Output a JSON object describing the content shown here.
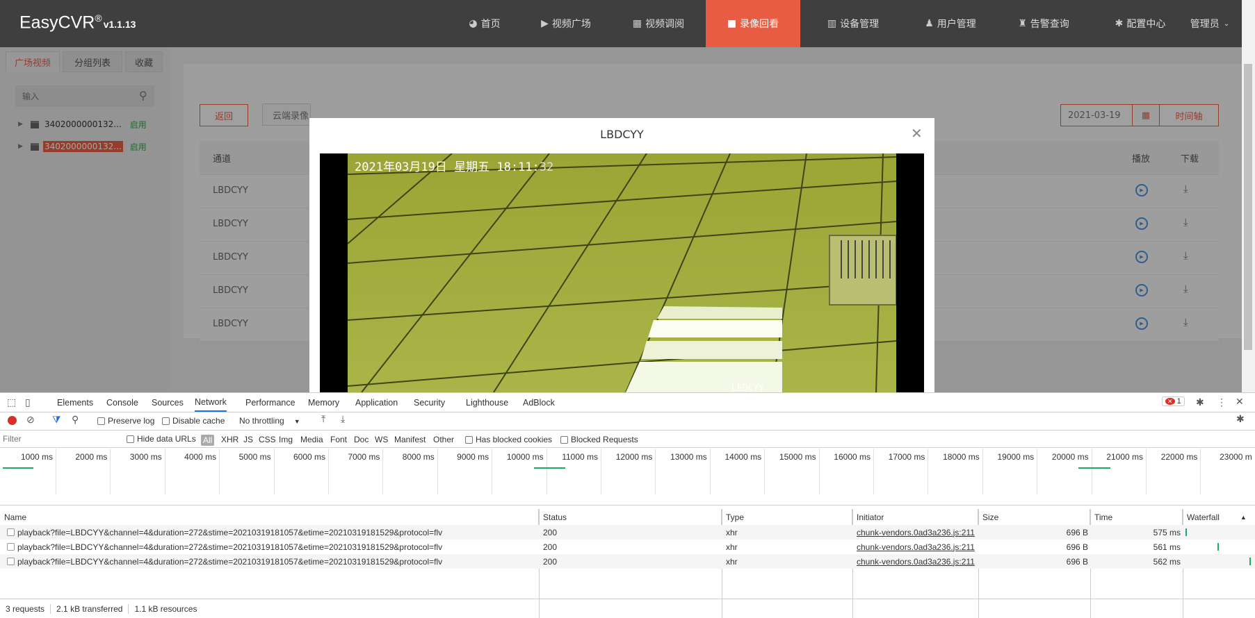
{
  "app": {
    "logo": "EasyCVR",
    "logo_reg": "®",
    "version": "v1.1.13"
  },
  "nav": [
    {
      "label": "首页",
      "icon": "dashboard-icon"
    },
    {
      "label": "视频广场",
      "icon": "play-circle-icon"
    },
    {
      "label": "视频调阅",
      "icon": "grid-icon"
    },
    {
      "label": "录像回看",
      "icon": "video-camera-icon"
    },
    {
      "label": "设备管理",
      "icon": "device-icon"
    },
    {
      "label": "用户管理",
      "icon": "user-icon"
    },
    {
      "label": "告警查询",
      "icon": "alarm-icon"
    },
    {
      "label": "配置中心",
      "icon": "gear-icon"
    }
  ],
  "nav_user": "管理员",
  "sidebar": {
    "tabs": [
      "广场视频",
      "分组列表",
      "收藏"
    ],
    "search_placeholder": "输入",
    "devices": [
      {
        "id": "3402000000132...",
        "status": "启用",
        "selected": false
      },
      {
        "id": "3402000000132...",
        "status": "启用",
        "selected": true
      }
    ]
  },
  "main": {
    "back_label": "返回",
    "cloud_label": "云端录像",
    "date": "2021-03-19",
    "timeline_label": "时间轴",
    "columns": {
      "channel": "通道",
      "play": "播放",
      "download": "下载"
    },
    "rows": [
      "LBDCYY",
      "LBDCYY",
      "LBDCYY",
      "LBDCYY",
      "LBDCYY"
    ]
  },
  "modal": {
    "title": "LBDCYY",
    "osd_date": "2021年03月19日  星期五  18:11:",
    "osd_sec": "32",
    "osd_corner": "LBDCYY"
  },
  "devtools": {
    "tabs": [
      "Elements",
      "Console",
      "Sources",
      "Network",
      "Performance",
      "Memory",
      "Application",
      "Security",
      "Lighthouse",
      "AdBlock"
    ],
    "active_tab": "Network",
    "error_count": "1",
    "toolbar": {
      "preserve_log": "Preserve log",
      "disable_cache": "Disable cache",
      "throttling": "No throttling"
    },
    "filter": {
      "placeholder": "Filter",
      "hide_data_urls": "Hide data URLs",
      "types": [
        "All",
        "XHR",
        "JS",
        "CSS",
        "Img",
        "Media",
        "Font",
        "Doc",
        "WS",
        "Manifest",
        "Other"
      ],
      "has_blocked_cookies": "Has blocked cookies",
      "blocked_requests": "Blocked Requests"
    },
    "ticks": [
      "1000 ms",
      "2000 ms",
      "3000 ms",
      "4000 ms",
      "5000 ms",
      "6000 ms",
      "7000 ms",
      "8000 ms",
      "9000 ms",
      "10000 ms",
      "11000 ms",
      "12000 ms",
      "13000 ms",
      "14000 ms",
      "15000 ms",
      "16000 ms",
      "17000 ms",
      "18000 ms",
      "19000 ms",
      "20000 ms",
      "21000 ms",
      "22000 ms",
      "23000 m"
    ],
    "columns": [
      "Name",
      "Status",
      "Type",
      "Initiator",
      "Size",
      "Time",
      "Waterfall"
    ],
    "requests": [
      {
        "name": "playback?file=LBDCYY&channel=4&duration=272&stime=20210319181057&etime=20210319181529&protocol=flv",
        "status": "200",
        "type": "xhr",
        "initiator": "chunk-vendors.0ad3a236.js:211",
        "size": "696 B",
        "time": "575 ms"
      },
      {
        "name": "playback?file=LBDCYY&channel=4&duration=272&stime=20210319181057&etime=20210319181529&protocol=flv",
        "status": "200",
        "type": "xhr",
        "initiator": "chunk-vendors.0ad3a236.js:211",
        "size": "696 B",
        "time": "561 ms"
      },
      {
        "name": "playback?file=LBDCYY&channel=4&duration=272&stime=20210319181057&etime=20210319181529&protocol=flv",
        "status": "200",
        "type": "xhr",
        "initiator": "chunk-vendors.0ad3a236.js:211",
        "size": "696 B",
        "time": "562 ms"
      }
    ],
    "status": {
      "requests": "3 requests",
      "transferred": "2.1 kB transferred",
      "resources": "1.1 kB resources"
    }
  }
}
